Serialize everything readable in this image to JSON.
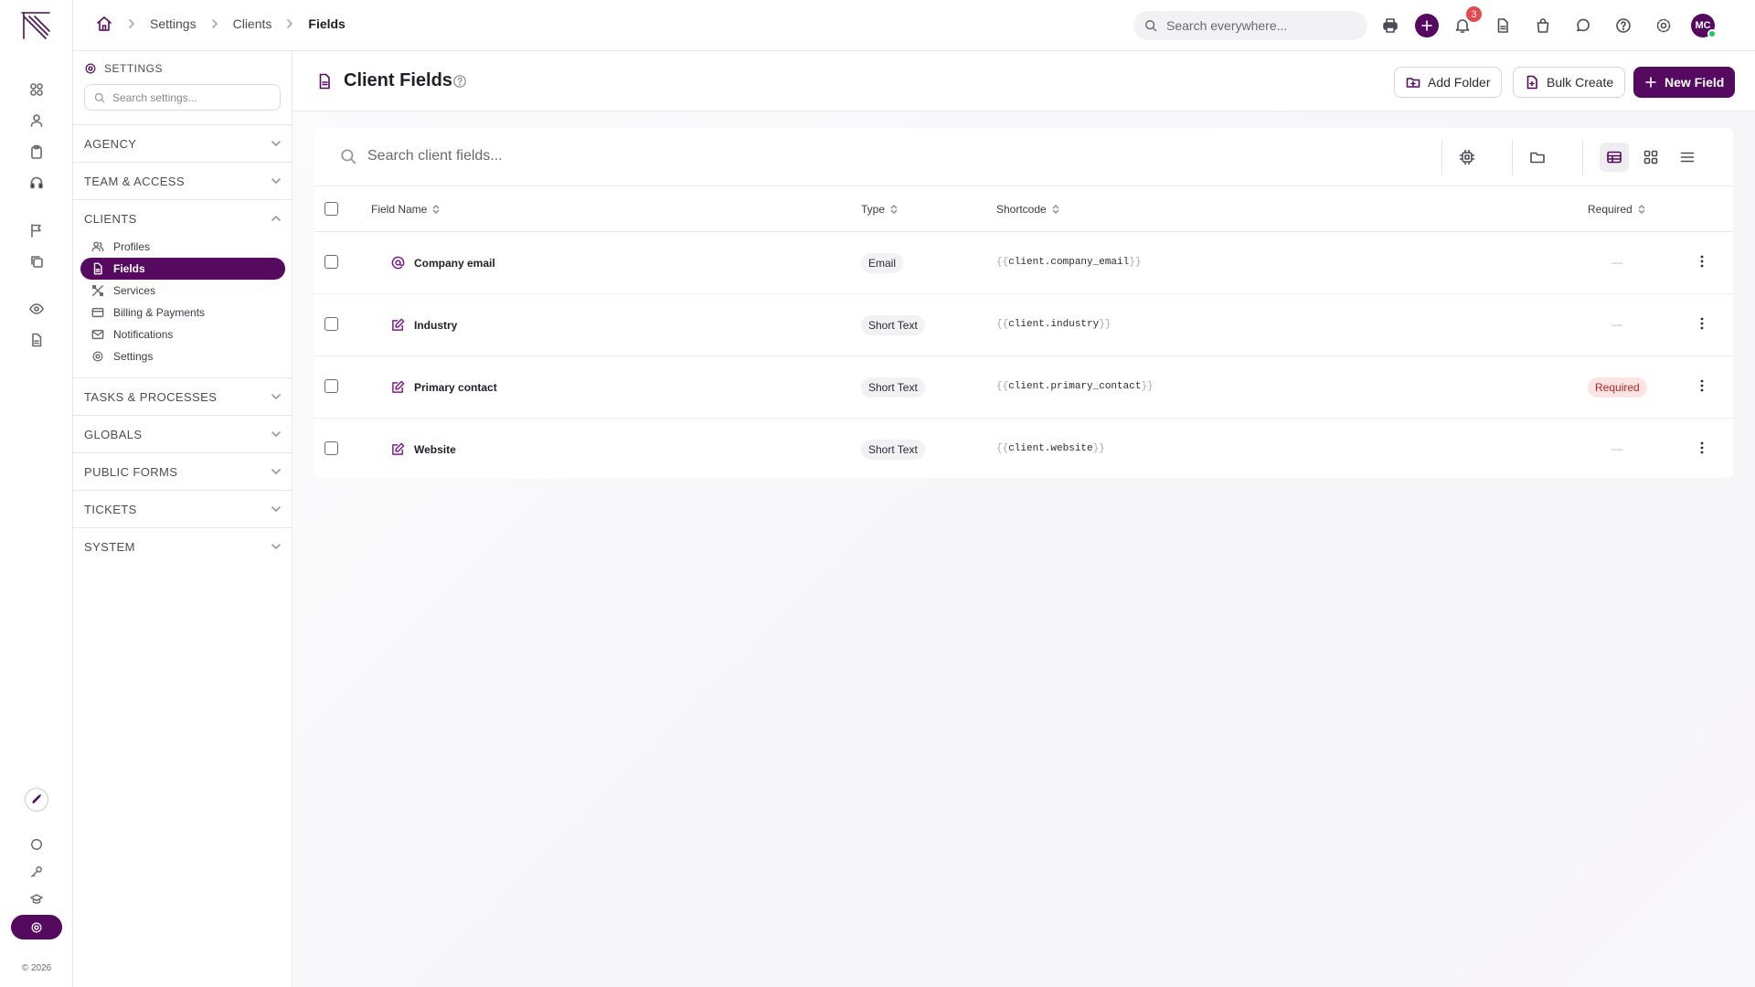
{
  "breadcrumb": [
    "Settings",
    "Clients",
    "Fields"
  ],
  "topbar": {
    "search_placeholder": "Search everywhere...",
    "notification_count": "3",
    "avatar_initials": "MC"
  },
  "rail": {
    "copyright": "© 2026"
  },
  "sidebar": {
    "title": "SETTINGS",
    "search_placeholder": "Search settings...",
    "sections": [
      "AGENCY",
      "TEAM & ACCESS",
      "CLIENTS",
      "TASKS & PROCESSES",
      "GLOBALS",
      "PUBLIC FORMS",
      "TICKETS",
      "SYSTEM"
    ],
    "client_items": [
      "Profiles",
      "Fields",
      "Services",
      "Billing & Payments",
      "Notifications",
      "Settings"
    ],
    "active_item": "Fields"
  },
  "page": {
    "title": "Client Fields",
    "add_folder": "Add Folder",
    "bulk_create": "Bulk Create",
    "new_field": "New Field",
    "search_placeholder": "Search client fields..."
  },
  "table": {
    "columns": [
      "Field Name",
      "Type",
      "Shortcode",
      "Required"
    ],
    "rows": [
      {
        "name": "Company email",
        "icon": "at-sign-icon",
        "type": "Email",
        "shortcode": "client.company_email",
        "required": "—"
      },
      {
        "name": "Industry",
        "icon": "edit-icon",
        "type": "Short Text",
        "shortcode": "client.industry",
        "required": "—"
      },
      {
        "name": "Primary contact",
        "icon": "edit-icon",
        "type": "Short Text",
        "shortcode": "client.primary_contact",
        "required": "Required"
      },
      {
        "name": "Website",
        "icon": "edit-icon",
        "type": "Short Text",
        "shortcode": "client.website",
        "required": "—"
      }
    ],
    "brace_open": "{{",
    "brace_close": "}}"
  },
  "colors": {
    "brand": "#550a60",
    "danger_badge": "#e5484d",
    "required_bg": "#fde4e4",
    "required_text": "#b42323"
  }
}
